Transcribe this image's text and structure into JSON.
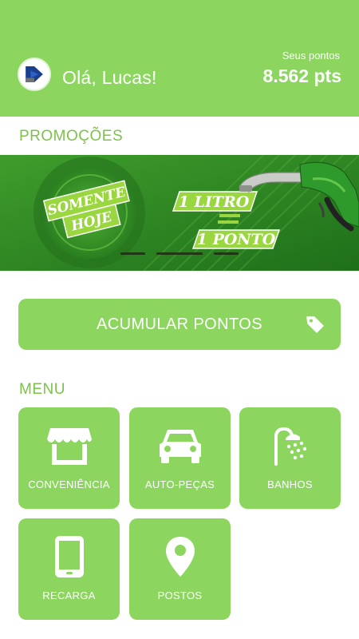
{
  "header": {
    "greeting": "Olá, Lucas!",
    "points_label": "Seus pontos",
    "points_value": "8.562 pts",
    "logo_icon": "brand-logo-icon"
  },
  "promotions": {
    "title": "PROMOÇÕES",
    "banner": {
      "badge_line1": "SOMENTE",
      "badge_line2": "HOJE",
      "offer_line1": "1 LITRO",
      "offer_equals": "=",
      "offer_line2": "1 PONTO",
      "image_icon": "fuel-nozzle-icon"
    },
    "slide_count": 3,
    "active_slide": 2
  },
  "accumulate": {
    "label": "ACUMULAR PONTOS",
    "icon": "tag-icon"
  },
  "menu": {
    "title": "MENU",
    "items": [
      {
        "label": "CONVENIÊNCIA",
        "icon": "store-icon"
      },
      {
        "label": "AUTO-PEÇAS",
        "icon": "car-icon"
      },
      {
        "label": "BANHOS",
        "icon": "shower-icon"
      },
      {
        "label": "RECARGA",
        "icon": "smartphone-icon"
      },
      {
        "label": "POSTOS",
        "icon": "map-pin-icon"
      }
    ]
  },
  "colors": {
    "primary": "#8cd660",
    "accent_text": "#7cc24a",
    "banner_green": "#2e8a25",
    "logo_blue": "#1b3f8f"
  }
}
